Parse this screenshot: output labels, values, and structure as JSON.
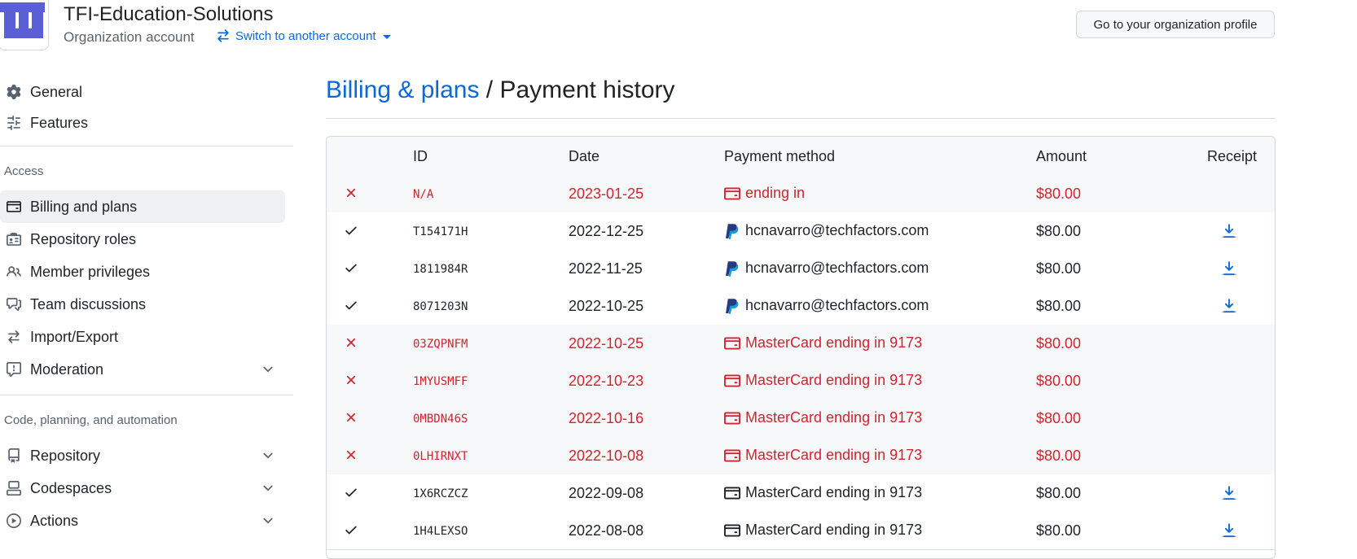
{
  "header": {
    "org_name": "TFI-Education-Solutions",
    "org_subtitle": "Organization account",
    "switch_label": "Switch to another account",
    "profile_button": "Go to your organization profile"
  },
  "sidebar": {
    "items_top": [
      {
        "label": "General",
        "icon": "gear-icon"
      },
      {
        "label": "Features",
        "icon": "sliders-icon"
      }
    ],
    "access_heading": "Access",
    "access_items": [
      {
        "label": "Billing and plans",
        "icon": "credit-card-icon",
        "active": true
      },
      {
        "label": "Repository roles",
        "icon": "id-badge-icon"
      },
      {
        "label": "Member privileges",
        "icon": "people-icon"
      },
      {
        "label": "Team discussions",
        "icon": "comment-discussion-icon"
      },
      {
        "label": "Import/Export",
        "icon": "arrow-switch-icon"
      },
      {
        "label": "Moderation",
        "icon": "report-icon",
        "expandable": true
      }
    ],
    "code_heading": "Code, planning, and automation",
    "code_items": [
      {
        "label": "Repository",
        "icon": "repo-icon",
        "expandable": true
      },
      {
        "label": "Codespaces",
        "icon": "codespaces-icon",
        "expandable": true
      },
      {
        "label": "Actions",
        "icon": "play-icon",
        "expandable": true
      }
    ]
  },
  "main": {
    "breadcrumb_link": "Billing & plans",
    "breadcrumb_sep": " / ",
    "breadcrumb_current": "Payment history"
  },
  "table": {
    "headers": {
      "id": "ID",
      "date": "Date",
      "method": "Payment method",
      "amount": "Amount",
      "receipt": "Receipt"
    },
    "rows": [
      {
        "status": "failed",
        "id": "N/A",
        "date": "2023-01-25",
        "method": "ending in",
        "method_icon": "credit-card-icon",
        "amount": "$80.00",
        "receipt": false
      },
      {
        "status": "success",
        "id": "T154171H",
        "date": "2022-12-25",
        "method": "hcnavarro@techfactors.com",
        "method_icon": "paypal-icon",
        "amount": "$80.00",
        "receipt": true
      },
      {
        "status": "success",
        "id": "1811984R",
        "date": "2022-11-25",
        "method": "hcnavarro@techfactors.com",
        "method_icon": "paypal-icon",
        "amount": "$80.00",
        "receipt": true
      },
      {
        "status": "success",
        "id": "8071203N",
        "date": "2022-10-25",
        "method": "hcnavarro@techfactors.com",
        "method_icon": "paypal-icon",
        "amount": "$80.00",
        "receipt": true
      },
      {
        "status": "failed",
        "id": "03ZQPNFM",
        "date": "2022-10-25",
        "method": "MasterCard ending in 9173",
        "method_icon": "credit-card-icon",
        "amount": "$80.00",
        "receipt": false
      },
      {
        "status": "failed",
        "id": "1MYUSMFF",
        "date": "2022-10-23",
        "method": "MasterCard ending in 9173",
        "method_icon": "credit-card-icon",
        "amount": "$80.00",
        "receipt": false
      },
      {
        "status": "failed",
        "id": "0MBDN46S",
        "date": "2022-10-16",
        "method": "MasterCard ending in 9173",
        "method_icon": "credit-card-icon",
        "amount": "$80.00",
        "receipt": false
      },
      {
        "status": "failed",
        "id": "0LHIRNXT",
        "date": "2022-10-08",
        "method": "MasterCard ending in 9173",
        "method_icon": "credit-card-icon",
        "amount": "$80.00",
        "receipt": false
      },
      {
        "status": "success",
        "id": "1X6RCZCZ",
        "date": "2022-09-08",
        "method": "MasterCard ending in 9173",
        "method_icon": "credit-card-icon",
        "amount": "$80.00",
        "receipt": true
      },
      {
        "status": "success",
        "id": "1H4LEXSO",
        "date": "2022-08-08",
        "method": "MasterCard ending in 9173",
        "method_icon": "credit-card-icon",
        "amount": "$80.00",
        "receipt": true
      }
    ]
  },
  "colors": {
    "accent": "#0969da",
    "danger": "#d1242f",
    "logo": "#5a5fd6"
  }
}
